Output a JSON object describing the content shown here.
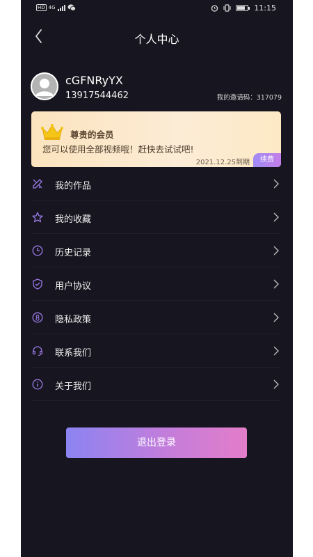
{
  "status_bar": {
    "left_icons": [
      "hd-icon",
      "signal-icon",
      "wechat-icon"
    ],
    "signal_label": "4G",
    "right_icons": [
      "alarm-icon",
      "vibrate-icon",
      "battery-icon"
    ],
    "time": "11:15"
  },
  "header": {
    "title": "个人中心",
    "back_icon": "chevron-left-icon"
  },
  "profile": {
    "username": "cGFNRyYX",
    "phone": "13917544462",
    "invite_code": "我的邀请码：317079"
  },
  "vip": {
    "title": "尊贵的会员",
    "description": "您可以使用全部视频哦！赶快去试试吧!",
    "expire": "2021.12.25到期",
    "renew_label": "续费",
    "icon": "crown-icon"
  },
  "menu": {
    "items": [
      {
        "label": "我的作品",
        "icon": "pencil-icon"
      },
      {
        "label": "我的收藏",
        "icon": "star-icon"
      },
      {
        "label": "历史记录",
        "icon": "clock-icon"
      },
      {
        "label": "用户协议",
        "icon": "shield-check-icon"
      },
      {
        "label": "隐私政策",
        "icon": "privacy-icon"
      },
      {
        "label": "联系我们",
        "icon": "headset-icon"
      },
      {
        "label": "关于我们",
        "icon": "info-icon"
      }
    ]
  },
  "logout": {
    "label": "退出登录"
  },
  "colors": {
    "background": "#17151f",
    "accent_purple": "#9b7be8",
    "vip_gold": "#f5c518",
    "button_gradient_start": "#8b84f2",
    "button_gradient_end": "#e37dc9"
  }
}
